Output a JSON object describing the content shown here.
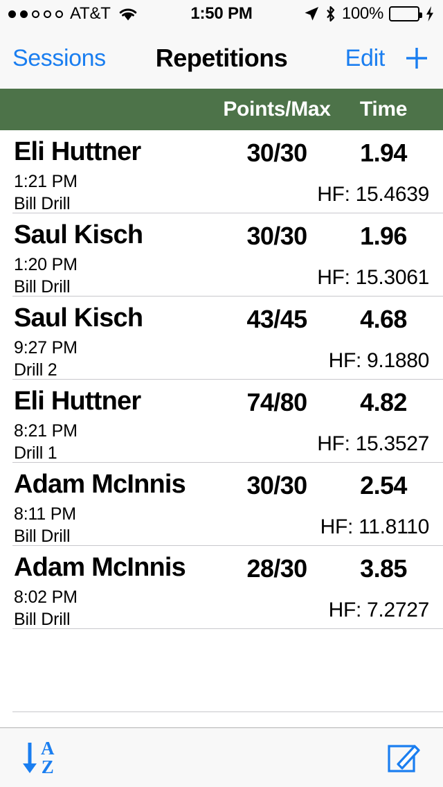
{
  "statusbar": {
    "signal_dots_filled": 2,
    "signal_dots_total": 5,
    "carrier": "AT&T",
    "wifi_icon": "wifi-icon",
    "time": "1:50 PM",
    "location_icon": "location-arrow-icon",
    "bluetooth_icon": "bluetooth-icon",
    "battery_percent": "100%",
    "battery_color": "#4cd964",
    "charging_icon": "lightning-bolt-icon"
  },
  "navbar": {
    "back_label": "Sessions",
    "title": "Repetitions",
    "edit_label": "Edit",
    "add_icon": "plus-icon",
    "tint_color": "#1a7ef0"
  },
  "column_header": {
    "background_color": "#4d7349",
    "points_label": "Points/Max",
    "time_label": "Time"
  },
  "rows": [
    {
      "name": "Eli Huttner",
      "score": "30/30",
      "time": "1.94",
      "clock": "1:21 PM",
      "drill": "Bill Drill",
      "hf": "HF: 15.4639"
    },
    {
      "name": "Saul Kisch",
      "score": "30/30",
      "time": "1.96",
      "clock": "1:20 PM",
      "drill": "Bill Drill",
      "hf": "HF: 15.3061"
    },
    {
      "name": "Saul Kisch",
      "score": "43/45",
      "time": "4.68",
      "clock": "9:27 PM",
      "drill": "Drill 2",
      "hf": "HF: 9.1880"
    },
    {
      "name": "Eli Huttner",
      "score": "74/80",
      "time": "4.82",
      "clock": "8:21 PM",
      "drill": "Drill 1",
      "hf": "HF: 15.3527"
    },
    {
      "name": "Adam McInnis",
      "score": "30/30",
      "time": "2.54",
      "clock": "8:11 PM",
      "drill": "Bill Drill",
      "hf": "HF: 11.8110"
    },
    {
      "name": "Adam McInnis",
      "score": "28/30",
      "time": "3.85",
      "clock": "8:02 PM",
      "drill": "Bill Drill",
      "hf": "HF: 7.2727"
    }
  ],
  "empty_rows": 1,
  "toolbar": {
    "sort_icon": "sort-a-to-z-icon",
    "sort_letter_top": "A",
    "sort_letter_bottom": "Z",
    "compose_icon": "compose-icon",
    "tint_color": "#1a7ef0"
  }
}
